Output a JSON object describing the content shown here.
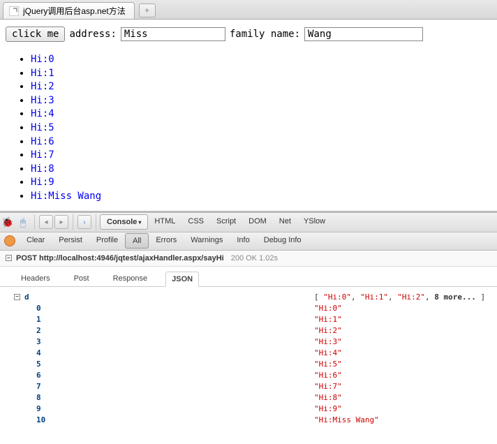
{
  "tab": {
    "title": "jQuery调用后台asp.net方法",
    "newtab_symbol": "+"
  },
  "form": {
    "click_label": "click me",
    "address_label": "address:",
    "address_value": "Miss",
    "family_label": "family name:",
    "family_value": "Wang"
  },
  "results": [
    "Hi:0",
    "Hi:1",
    "Hi:2",
    "Hi:3",
    "Hi:4",
    "Hi:5",
    "Hi:6",
    "Hi:7",
    "Hi:8",
    "Hi:9",
    "Hi:Miss Wang"
  ],
  "firebug": {
    "panels": [
      "Console",
      "HTML",
      "CSS",
      "Script",
      "DOM",
      "Net",
      "YSlow"
    ],
    "active_panel": "Console",
    "sub_buttons": [
      "Clear",
      "Persist",
      "Profile",
      "All",
      "Errors",
      "Warnings",
      "Info",
      "Debug Info"
    ],
    "active_sub": "All",
    "request": {
      "method": "POST",
      "url": "http://localhost:4946/jqtest/ajaxHandler.aspx/sayHi",
      "status": "200 OK 1.02s"
    },
    "resp_tabs": [
      "Headers",
      "Post",
      "Response",
      "JSON"
    ],
    "active_resp_tab": "JSON",
    "json": {
      "root_key": "d",
      "summary_parts": {
        "open": "[ ",
        "s1": "\"Hi:0\"",
        "c1": ", ",
        "s2": "\"Hi:1\"",
        "c2": ", ",
        "s3": "\"Hi:2\"",
        "c3": ", ",
        "more": "8 more...",
        "close": " ]"
      },
      "rows": [
        {
          "k": "0",
          "v": "\"Hi:0\""
        },
        {
          "k": "1",
          "v": "\"Hi:1\""
        },
        {
          "k": "2",
          "v": "\"Hi:2\""
        },
        {
          "k": "3",
          "v": "\"Hi:3\""
        },
        {
          "k": "4",
          "v": "\"Hi:4\""
        },
        {
          "k": "5",
          "v": "\"Hi:5\""
        },
        {
          "k": "6",
          "v": "\"Hi:6\""
        },
        {
          "k": "7",
          "v": "\"Hi:7\""
        },
        {
          "k": "8",
          "v": "\"Hi:8\""
        },
        {
          "k": "9",
          "v": "\"Hi:9\""
        },
        {
          "k": "10",
          "v": "\"Hi:Miss Wang\""
        }
      ]
    }
  }
}
